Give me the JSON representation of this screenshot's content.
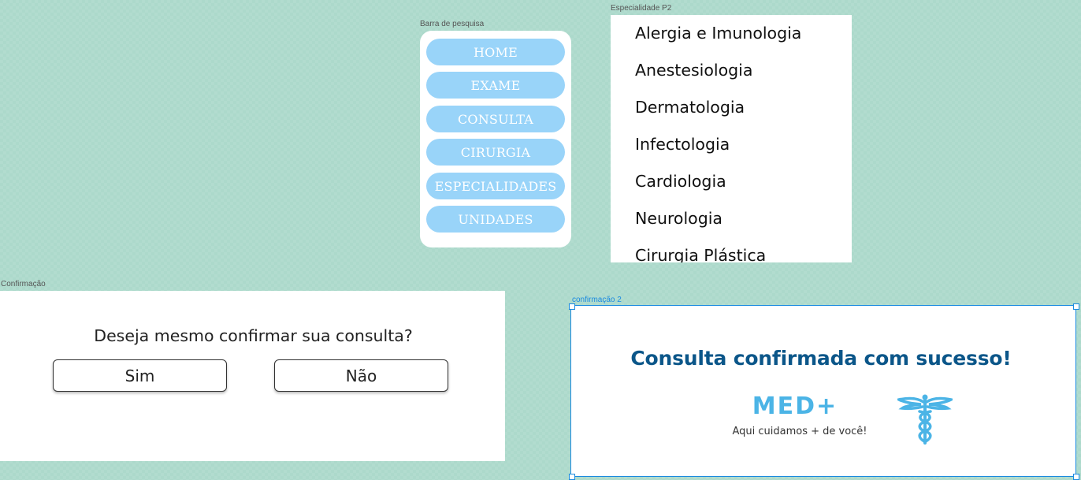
{
  "frames": {
    "search_bar": "Barra de pesquisa",
    "specialty": "Especialidade P2",
    "confirm": "Confirmação",
    "confirm2": "confirmação 2"
  },
  "nav": {
    "items": [
      "HOME",
      "EXAME",
      "CONSULTA",
      "CIRURGIA",
      "ESPECIALIDADES",
      "UNIDADES"
    ]
  },
  "specialties": {
    "items": [
      "Alergia  e Imunologia",
      "Anestesiologia",
      "Dermatologia",
      "Infectologia",
      "Cardiologia",
      "Neurologia",
      "Cirurgia Plástica"
    ]
  },
  "confirm": {
    "question": "Deseja mesmo confirmar sua consulta?",
    "yes": "Sim",
    "no": "Não"
  },
  "success": {
    "title": "Consulta confirmada com sucesso!",
    "logo_brand": "MED+",
    "logo_tagline": "Aqui cuidamos + de você!",
    "logo_icon": "caduceus-icon"
  },
  "colors": {
    "canvas": "#acd9cb",
    "nav_button": "#99d4f9",
    "title_blue": "#0b5689",
    "logo_blue": "#4bb4e6",
    "selection": "#1a8ae0"
  }
}
